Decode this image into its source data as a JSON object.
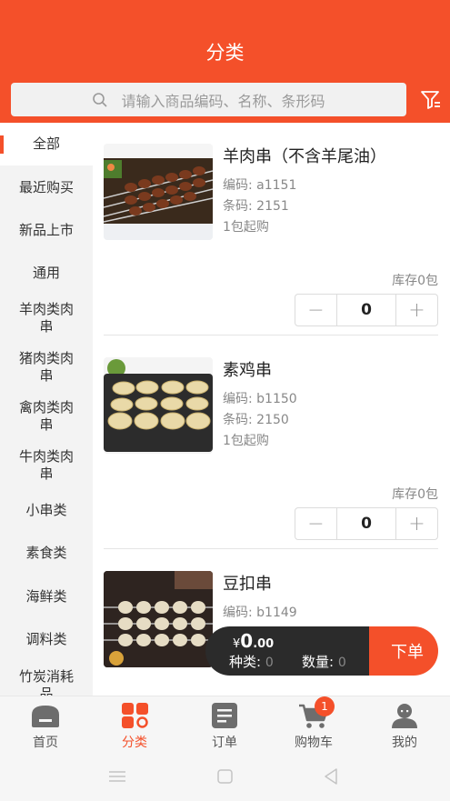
{
  "header": {
    "title": "分类"
  },
  "search": {
    "placeholder": "请输入商品编码、名称、条形码"
  },
  "sidebar": {
    "items": [
      {
        "label": "全部",
        "active": true
      },
      {
        "label": "最近购买"
      },
      {
        "label": "新品上市"
      },
      {
        "label": "通用"
      },
      {
        "label": "羊肉类肉串"
      },
      {
        "label": "猪肉类肉串"
      },
      {
        "label": "禽肉类肉串"
      },
      {
        "label": "牛肉类肉串"
      },
      {
        "label": "小串类"
      },
      {
        "label": "素食类"
      },
      {
        "label": "海鲜类"
      },
      {
        "label": "调料类"
      },
      {
        "label": "竹炭消耗品"
      }
    ]
  },
  "products": [
    {
      "name": "羊肉串（不含羊尾油）",
      "code": "编码: a1151",
      "barcode": "条码: 2151",
      "min": "1包起购",
      "stock": "库存0包",
      "qty": "0"
    },
    {
      "name": "素鸡串",
      "code": "编码: b1150",
      "barcode": "条码: 2150",
      "min": "1包起购",
      "stock": "库存0包",
      "qty": "0"
    },
    {
      "name": "豆扣串",
      "code": "编码: b1149"
    }
  ],
  "cart": {
    "currency": "¥",
    "amount_int": "0",
    "amount_dec": ".00",
    "kinds_label": "种类:",
    "kinds_value": "0",
    "qty_label": "数量:",
    "qty_value": "0",
    "order_label": "下单"
  },
  "tabs": [
    {
      "label": "首页",
      "icon": "home-icon"
    },
    {
      "label": "分类",
      "icon": "category-icon",
      "active": true
    },
    {
      "label": "订单",
      "icon": "order-icon"
    },
    {
      "label": "购物车",
      "icon": "cart-icon",
      "badge": "1"
    },
    {
      "label": "我的",
      "icon": "profile-icon"
    }
  ],
  "colors": {
    "accent": "#f4502a",
    "dark": "#2b2b2b"
  }
}
